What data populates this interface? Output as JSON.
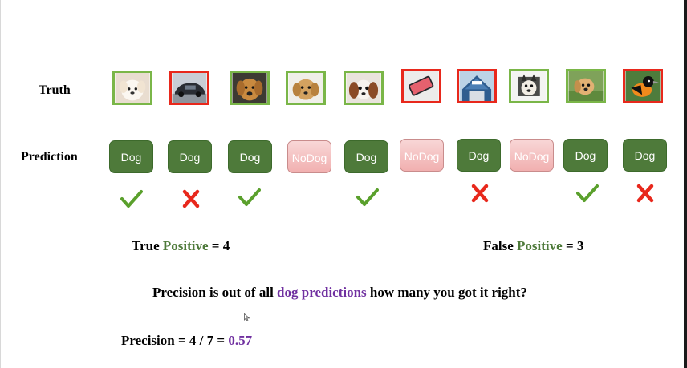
{
  "rows": {
    "truth_label": "Truth",
    "prediction_label": "Prediction"
  },
  "truth_images": [
    {
      "subject": "puppy",
      "is_dog": true
    },
    {
      "subject": "car",
      "is_dog": false
    },
    {
      "subject": "golden-retriever",
      "is_dog": true
    },
    {
      "subject": "dog",
      "is_dog": true
    },
    {
      "subject": "spaniel",
      "is_dog": true
    },
    {
      "subject": "phone",
      "is_dog": false
    },
    {
      "subject": "building",
      "is_dog": false
    },
    {
      "subject": "husky",
      "is_dog": true
    },
    {
      "subject": "puppy-in-grass",
      "is_dog": true
    },
    {
      "subject": "bird",
      "is_dog": false
    }
  ],
  "predictions": [
    {
      "label": "Dog",
      "label2": "",
      "type": "dog",
      "mark": "check"
    },
    {
      "label": "Dog",
      "label2": "",
      "type": "dog",
      "mark": "cross"
    },
    {
      "label": "Dog",
      "label2": "",
      "type": "dog",
      "mark": "check"
    },
    {
      "label": "No",
      "label2": "Dog",
      "type": "nodog",
      "mark": ""
    },
    {
      "label": "Dog",
      "label2": "",
      "type": "dog",
      "mark": "check"
    },
    {
      "label": "No",
      "label2": "Dog",
      "type": "nodog",
      "mark": ""
    },
    {
      "label": "Dog",
      "label2": "",
      "type": "dog",
      "mark": "cross"
    },
    {
      "label": "No",
      "label2": "Dog",
      "type": "nodog",
      "mark": ""
    },
    {
      "label": "Dog",
      "label2": "",
      "type": "dog",
      "mark": "check"
    },
    {
      "label": "Dog",
      "label2": "",
      "type": "dog",
      "mark": "cross"
    }
  ],
  "stats": {
    "true_positive": {
      "prefix": "True ",
      "highlight": "Positive",
      "suffix": " = 4"
    },
    "false_positive": {
      "prefix": "False ",
      "highlight": "Positive",
      "suffix": " = 3"
    }
  },
  "question": {
    "prefix": "Precision is out of all ",
    "highlight": "dog predictions",
    "suffix": " how many you got it right?"
  },
  "formula": {
    "prefix": "Precision = 4 / 7 = ",
    "result": "0.57"
  },
  "colors": {
    "dog_box_fill": "#4e7a3a",
    "nodog_box_fill": "#f4c4c4",
    "positive_border": "#7ab648",
    "negative_border": "#e8281c",
    "check": "#5aa02c",
    "cross": "#e8281c",
    "highlight_green": "#4e7a3a",
    "highlight_purple": "#7030a0"
  }
}
